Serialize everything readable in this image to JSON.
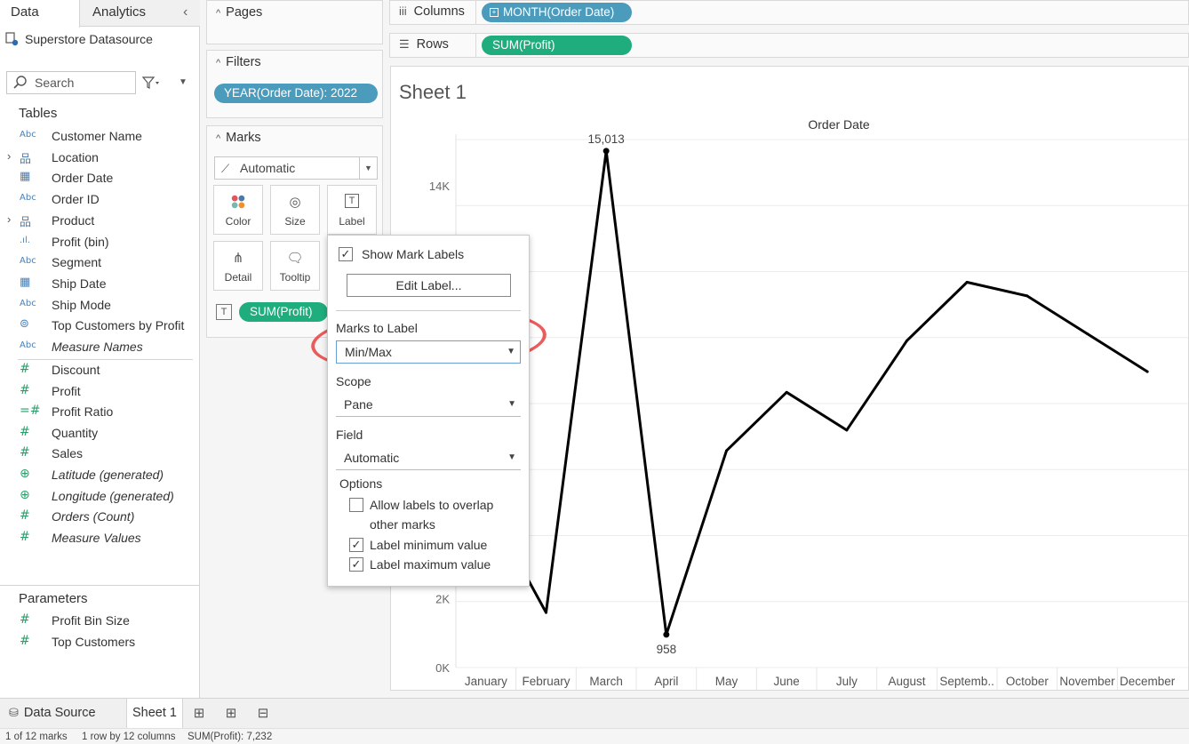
{
  "left_pane": {
    "tab_data": "Data",
    "tab_analytics": "Analytics",
    "datasource": "Superstore Datasource",
    "search_placeholder": "Search",
    "tables_title": "Tables",
    "dimensions": [
      {
        "name": "Customer Name",
        "icon": "Abc",
        "expander": "",
        "italic": false
      },
      {
        "name": "Location",
        "icon": "hierarchy",
        "expander": "›",
        "italic": false
      },
      {
        "name": "Order Date",
        "icon": "calendar",
        "expander": "",
        "italic": false
      },
      {
        "name": "Order ID",
        "icon": "Abc",
        "expander": "",
        "italic": false
      },
      {
        "name": "Product",
        "icon": "hierarchy",
        "expander": "›",
        "italic": false
      },
      {
        "name": "Profit (bin)",
        "icon": "bin",
        "expander": "",
        "italic": false
      },
      {
        "name": "Segment",
        "icon": "Abc",
        "expander": "",
        "italic": false
      },
      {
        "name": "Ship Date",
        "icon": "calendar",
        "expander": "",
        "italic": false
      },
      {
        "name": "Ship Mode",
        "icon": "Abc",
        "expander": "",
        "italic": false
      },
      {
        "name": "Top Customers by Profit",
        "icon": "set",
        "expander": "",
        "italic": false
      },
      {
        "name": "Measure Names",
        "icon": "Abc",
        "expander": "",
        "italic": true
      }
    ],
    "measures": [
      {
        "name": "Discount",
        "icon": "#",
        "italic": false
      },
      {
        "name": "Profit",
        "icon": "#",
        "italic": false
      },
      {
        "name": "Profit Ratio",
        "icon": "=#",
        "italic": false
      },
      {
        "name": "Quantity",
        "icon": "#",
        "italic": false
      },
      {
        "name": "Sales",
        "icon": "#",
        "italic": false
      },
      {
        "name": "Latitude (generated)",
        "icon": "globe",
        "italic": true
      },
      {
        "name": "Longitude (generated)",
        "icon": "globe",
        "italic": true
      },
      {
        "name": "Orders (Count)",
        "icon": "#",
        "italic": true
      },
      {
        "name": "Measure Values",
        "icon": "#",
        "italic": true
      }
    ],
    "parameters_title": "Parameters",
    "parameters": [
      {
        "name": "Profit Bin Size",
        "icon": "#"
      },
      {
        "name": "Top Customers",
        "icon": "#"
      }
    ]
  },
  "cards": {
    "pages_title": "Pages",
    "filters_title": "Filters",
    "filter_pill": "YEAR(Order Date): 2022",
    "marks_title": "Marks",
    "marks_type": "Automatic",
    "mark_buttons": [
      "Color",
      "Size",
      "Label",
      "Detail",
      "Tooltip"
    ],
    "label_pill": "SUM(Profit)"
  },
  "shelves": {
    "columns_label": "Columns",
    "columns_pill": "MONTH(Order Date)",
    "rows_label": "Rows",
    "rows_pill": "SUM(Profit)"
  },
  "sheet": {
    "title": "Sheet 1"
  },
  "chart_data": {
    "type": "line",
    "title": "Order Date",
    "categories": [
      "January",
      "February",
      "March",
      "April",
      "May",
      "June",
      "July",
      "August",
      "Septemb..",
      "October",
      "November",
      "December"
    ],
    "values": [
      4800,
      1600,
      15013,
      958,
      6300,
      8000,
      6900,
      9500,
      11200,
      10800,
      9700,
      8600
    ],
    "y_ticks": [
      "0K",
      "2K",
      "14K"
    ],
    "y_tick_values": [
      0,
      2000,
      14000
    ],
    "ylim": [
      0,
      15500
    ],
    "data_labels": [
      {
        "index": 2,
        "text": "15,013"
      },
      {
        "index": 3,
        "text": "958"
      }
    ],
    "line_color": "#000000",
    "grid": true
  },
  "popup": {
    "show_mark_labels": "Show Mark Labels",
    "edit_label": "Edit Label...",
    "marks_to_label_title": "Marks to Label",
    "marks_to_label_value": "Min/Max",
    "scope_title": "Scope",
    "scope_value": "Pane",
    "field_title": "Field",
    "field_value": "Automatic",
    "options_title": "Options",
    "opt_overlap_line1": "Allow labels to overlap",
    "opt_overlap_line2": "other marks",
    "opt_min": "Label minimum value",
    "opt_max": "Label maximum value"
  },
  "bottom": {
    "data_source_tab": "Data Source",
    "sheet_tab": "Sheet 1",
    "status_marks": "1 of 12 marks",
    "status_rows": "1 row by 12 columns",
    "status_sum": "SUM(Profit): 7,232"
  },
  "colors": {
    "blue_pill": "#4b9bbd",
    "green_pill": "#1fad7d",
    "highlight": "#e8403f"
  }
}
